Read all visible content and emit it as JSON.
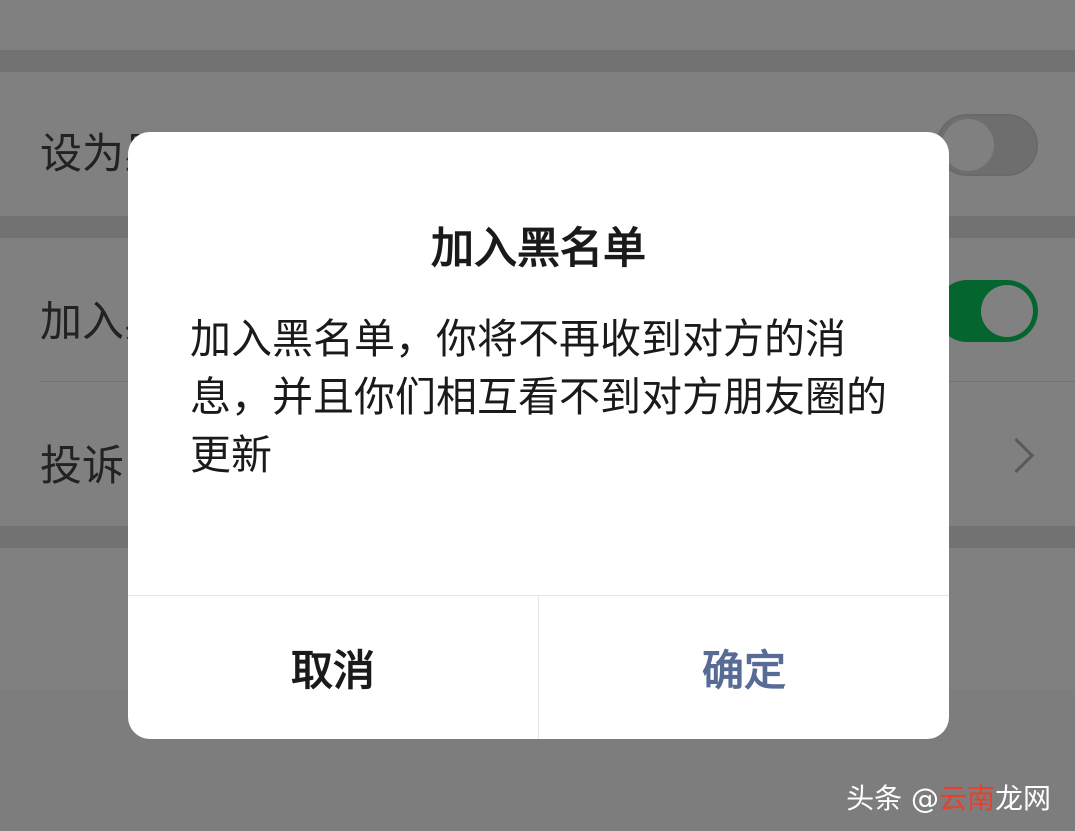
{
  "background": {
    "rows": [
      {
        "label": "设为星标朋友",
        "control": "switch",
        "state": "off"
      },
      {
        "label": "加入黑名单",
        "control": "switch",
        "state": "on"
      },
      {
        "label": "投诉",
        "control": "chevron"
      }
    ]
  },
  "dialog": {
    "title": "加入黑名单",
    "message": "加入黑名单，你将不再收到对方的消息，并且你们相互看不到对方朋友圈的更新",
    "cancel_label": "取消",
    "confirm_label": "确定"
  },
  "watermark": {
    "prefix": "头条 @",
    "middle": "云南",
    "suffix": "龙网"
  },
  "colors": {
    "confirm": "#576b95",
    "switch_on": "#07c160",
    "overlay": "#808080"
  }
}
